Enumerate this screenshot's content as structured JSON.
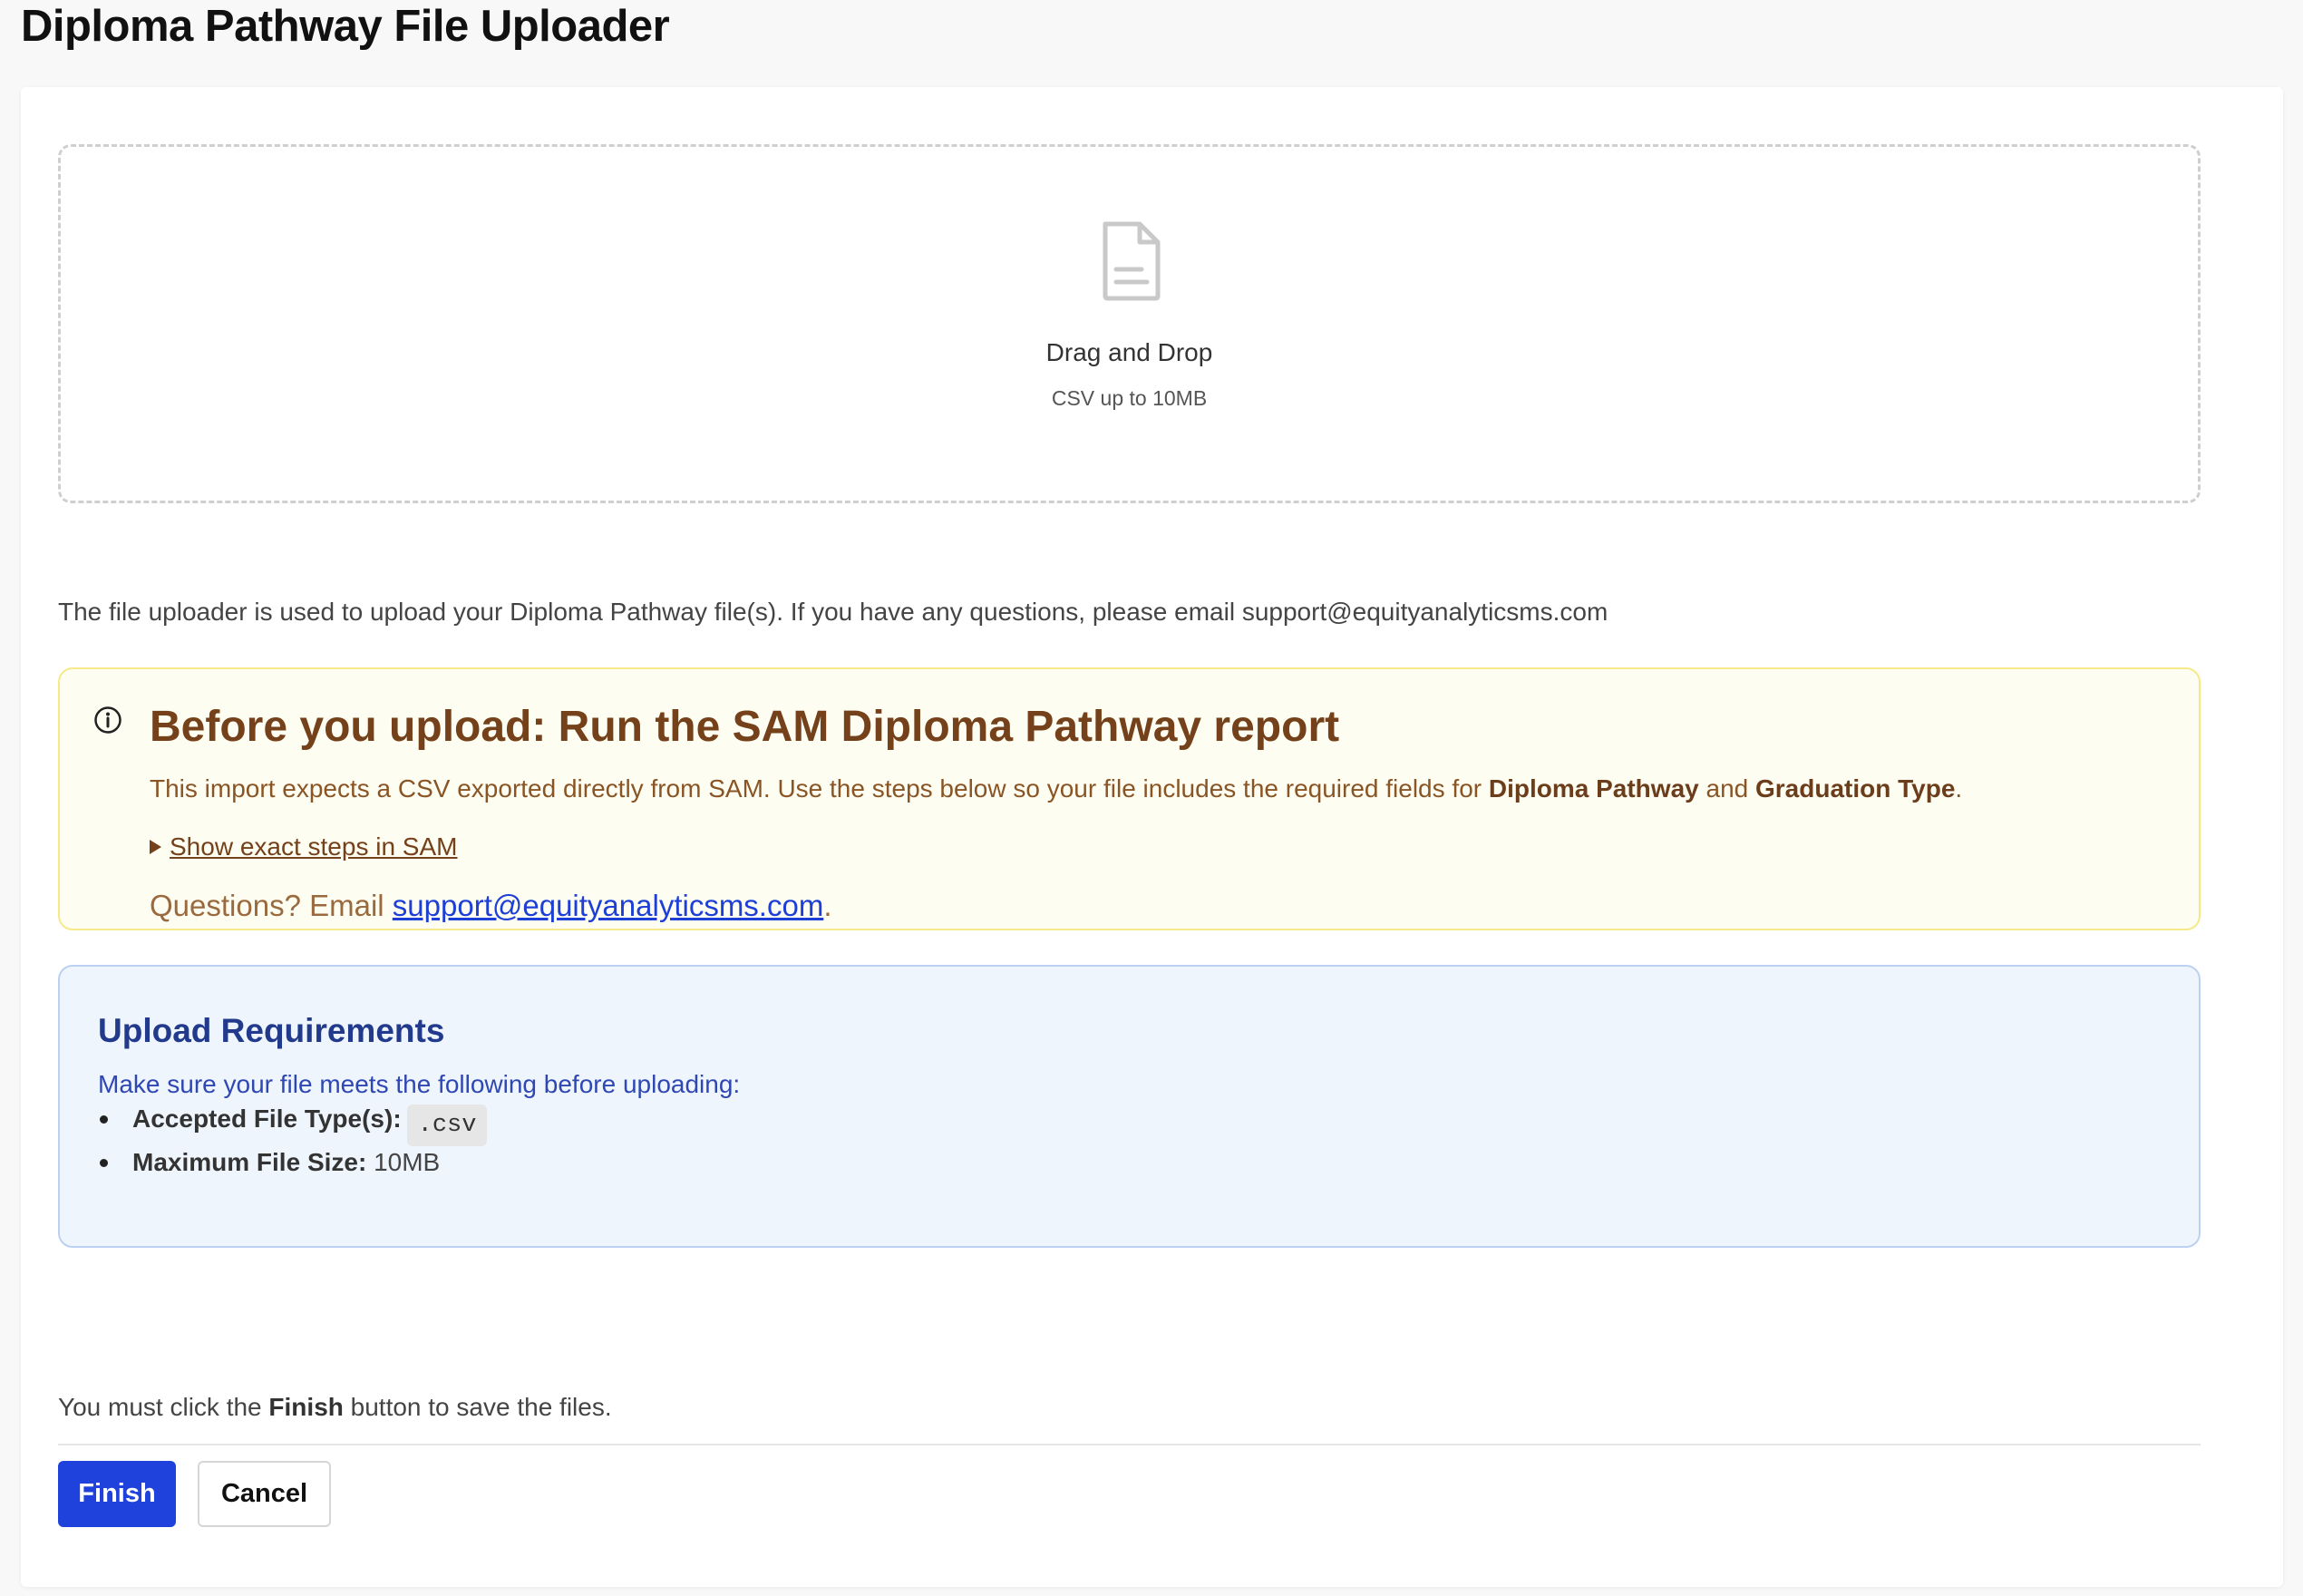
{
  "header": {
    "title": "Diploma Pathway File Uploader"
  },
  "dropzone": {
    "icon": "document-icon",
    "title": "Drag and Drop",
    "subtitle": "CSV up to 10MB"
  },
  "intro_text": "The file uploader is used to upload your Diploma Pathway file(s). If you have any questions, please email support@equityanalyticsms.com",
  "notice": {
    "icon": "info-icon",
    "heading": "Before you upload: Run the SAM Diploma Pathway report",
    "body_prefix": "This import expects a CSV exported directly from SAM. Use the steps below so your file includes the required fields for ",
    "field_1": "Diploma Pathway",
    "body_and": " and ",
    "field_2": "Graduation Type",
    "body_suffix": ".",
    "steps_toggle_label": "Show exact steps in SAM",
    "questions_prefix": "Questions? Email ",
    "email": "support@equityanalyticsms.com",
    "questions_suffix": "."
  },
  "requirements": {
    "heading": "Upload Requirements",
    "subtitle": "Make sure your file meets the following before uploading:",
    "items": [
      {
        "label": "Accepted File Type(s):",
        "value": ".csv"
      },
      {
        "label": "Maximum File Size:",
        "value": "10MB"
      }
    ]
  },
  "footer": {
    "note_prefix": "You must click the ",
    "note_bold": "Finish",
    "note_suffix": " button to save the files.",
    "finish_label": "Finish",
    "cancel_label": "Cancel"
  },
  "colors": {
    "primary_button": "#1e42db",
    "notice_background": "#fefdf2",
    "notice_border": "#f6e98a",
    "notice_heading": "#74411a",
    "requirements_background": "#eff5fd",
    "requirements_heading": "#213a8c",
    "link": "#1d3fd6"
  }
}
